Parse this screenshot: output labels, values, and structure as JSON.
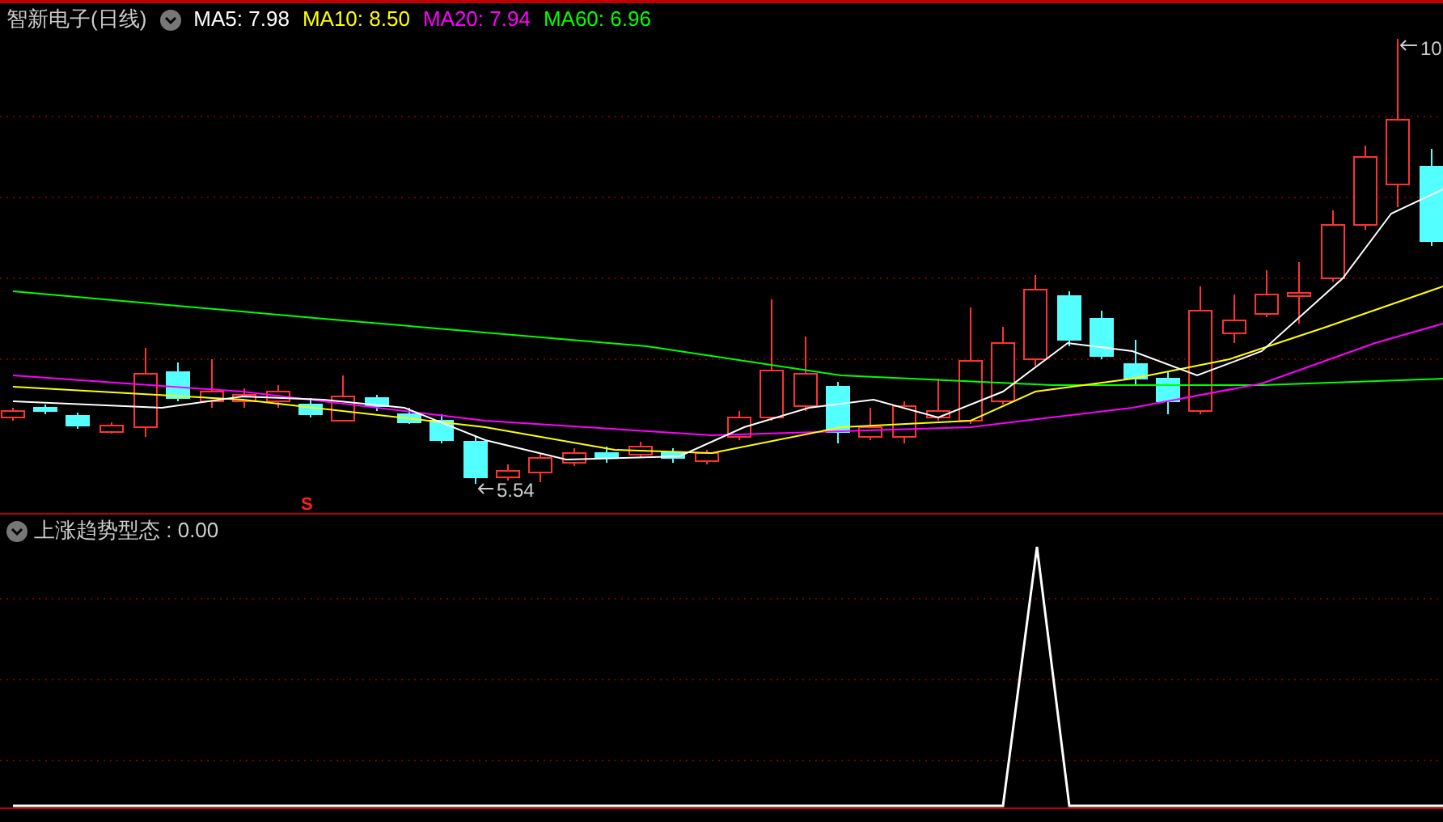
{
  "header": {
    "title": "智新电子(日线)",
    "ma": [
      {
        "label": "MA5: 7.98",
        "color": "#ffffff"
      },
      {
        "label": "MA10: 8.50",
        "color": "#ffff00"
      },
      {
        "label": "MA20: 7.94",
        "color": "#ff00ff"
      },
      {
        "label": "MA60: 6.96",
        "color": "#00ff00"
      }
    ]
  },
  "price_labels": {
    "low": "5.54",
    "high": "10"
  },
  "signal_mark": "S",
  "indicator": {
    "title": "上涨趋势型态 : 0.00"
  }
}
